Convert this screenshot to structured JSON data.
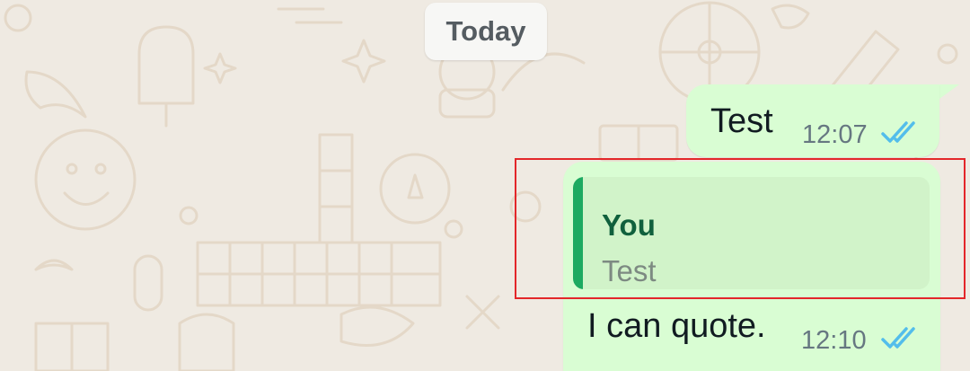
{
  "date_chip": {
    "label": "Today"
  },
  "messages": [
    {
      "text": "Test",
      "time": "12:07",
      "status_icon": "double-check-read-icon"
    },
    {
      "quote": {
        "author": "You",
        "text": "Test"
      },
      "text": "I can quote.",
      "time": "12:10",
      "status_icon": "double-check-read-icon"
    }
  ],
  "colors": {
    "wallpaper": "#efeae2",
    "doodle": "#e4d8c8",
    "outgoing_bubble": "#d9fdd3",
    "quote_background": "#d1f3c9",
    "quote_bar": "#1daa61",
    "quote_author": "#10603d",
    "read_ticks": "#53bdeb",
    "highlight_box": "#e3272a"
  }
}
